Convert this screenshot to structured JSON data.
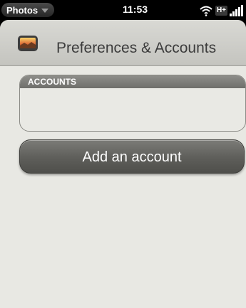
{
  "status_bar": {
    "app_name": "Photos",
    "time": "11:53",
    "network_type": "H+"
  },
  "header": {
    "title": "Preferences & Accounts",
    "icon": "photos-app-icon"
  },
  "accounts": {
    "section_label": "ACCOUNTS",
    "items": []
  },
  "actions": {
    "add_account_label": "Add an account"
  },
  "colors": {
    "background": "#e8e8e3",
    "header": "#cfcfca",
    "section_label_bg": "#7f7f7b",
    "button": "#5e5e5a"
  }
}
